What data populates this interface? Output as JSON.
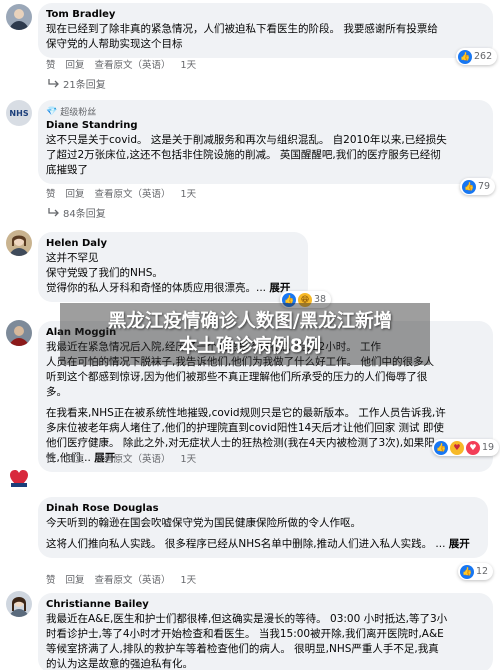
{
  "actions": {
    "like": "赞",
    "reply": "回复",
    "see_original": "查看原文（英语）"
  },
  "comments": [
    {
      "name": "Tom Bradley",
      "lines": [
        "现在已经到了除非真的紧急情况，人们被迫私下看医生的阶段。 我要感谢所有投票给",
        "保守党的人帮助实现这个目标"
      ],
      "time": "1天",
      "reactions": "262",
      "replies": "21条回复"
    },
    {
      "badge": "超级粉丝",
      "name": "Diane Standring",
      "lines": [
        "这不只是关于covid。 这是关于削减服务和再次与组织混乱。 自2010年以来,已经损失",
        "了超过2万张床位,这还不包括非住院设施的削减。 英国醒醒吧,我们的医疗服务已经彻",
        "底摧毁了"
      ],
      "time": "1天",
      "reactions": "79",
      "replies": "84条回复"
    },
    {
      "name": "Helen Daly",
      "lines": [
        "这并不罕见",
        "保守党毁了我们的NHS。",
        "觉得你的私人牙科和奇怪的体质应用很漂亮。..."
      ],
      "more": "展开",
      "reactions": "38"
    },
    {
      "name": "Alan Moggin",
      "para1": [
        "我最近在紧急情况后入院,经历了一个我总是不得在急诊部12小时。 工作",
        "人员在可怕的情况下脱袜子,我告诉他们,他们为我做了什么好工作。 他们中的很多人",
        "听到这个都感到惊讶,因为他们被那些不真正理解他们所承受的压力的人们侮辱了很",
        "多。"
      ],
      "para2": [
        "在我看来,NHS正在被系统性地摧毁,covid规则只是它的最新版本。 工作人员告诉我,许",
        "多床位被老年病人堵住了,他们的护理院直到covid阳性14天后才让他们回家 测试 即使",
        "他们医疗健康。 除此之外,对无症状人士的狂热检测(我在4天内被检测了3次),如果阳",
        "性,他们..."
      ],
      "more": "展开",
      "time": "1天",
      "reactions": "19"
    },
    {
      "name": "Dinah Rose Douglas",
      "para1": [
        "今天听到的翰逊在国会吹嘘保守党为国民健康保险所做的令人作呕。"
      ],
      "para2": [
        "这将人们推向私人实践。 很多程序已经从NHS名单中删除,推动人们进入私人实践。 ..."
      ],
      "more": "展开",
      "time": "1天",
      "reactions": "12"
    },
    {
      "name": "Christianne Bailey",
      "lines": [
        "我最近在A&E,医生和护士们都很棒,但这确实是漫长的等待。 03:00 小时抵达,等了3小",
        "时看诊护士,等了4小时才开始检查和看医生。 当我15:00被开除,我们离开医院时,A&E",
        "等候室挤满了人,排队的救护车等着检查他们的病人。 很明显,NHS严重人手不足,我真",
        "的认为这是故意的强迫私有化。"
      ]
    }
  ],
  "overlay": {
    "line1": "黑龙江疫情确诊人数图/黑龙江新增",
    "line2": "本土确诊病例8例"
  }
}
